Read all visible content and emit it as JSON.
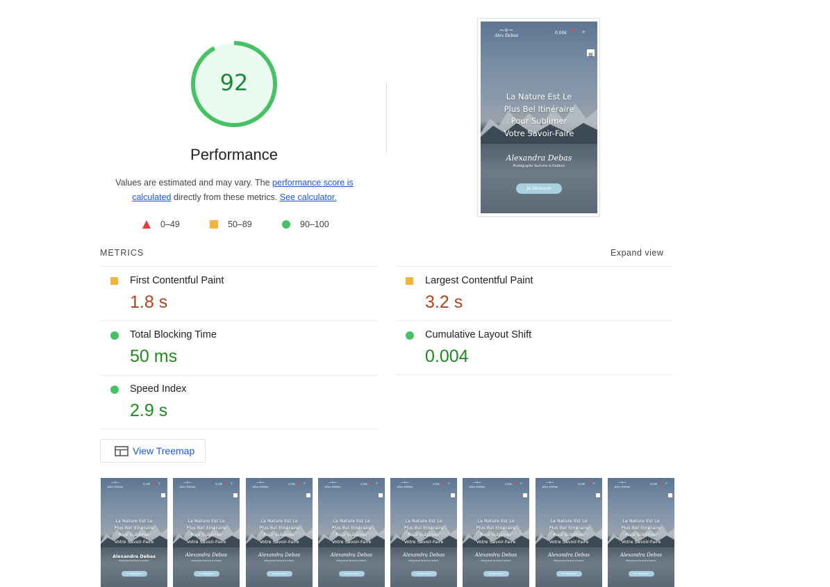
{
  "score": {
    "value": "92",
    "fraction": 0.92,
    "title": "Performance",
    "color": "#46c264"
  },
  "description": {
    "prefix": "Values are estimated and may vary. The ",
    "link1": "performance score is calculated",
    "middle": " directly from these metrics. ",
    "link2": "See calculator."
  },
  "legend": [
    {
      "shape": "triangle",
      "label": "0–49",
      "color": "#e53935"
    },
    {
      "shape": "square",
      "label": "50–89",
      "color": "#f4b33a"
    },
    {
      "shape": "circle",
      "label": "90–100",
      "color": "#46c264"
    }
  ],
  "metrics_header": "METRICS",
  "expand_label": "Expand view",
  "metrics": [
    {
      "name": "First Contentful Paint",
      "value": "1.8 s",
      "rating": "average"
    },
    {
      "name": "Largest Contentful Paint",
      "value": "3.2 s",
      "rating": "average"
    },
    {
      "name": "Total Blocking Time",
      "value": "50 ms",
      "rating": "pass"
    },
    {
      "name": "Cumulative Layout Shift",
      "value": "0.004",
      "rating": "pass"
    },
    {
      "name": "Speed Index",
      "value": "2.9 s",
      "rating": "pass"
    }
  ],
  "treemap_label": "View Treemap",
  "screenshot": {
    "logo_text": "Alex Debas",
    "cart_text": "0,00€",
    "headline_lines": [
      "La Nature Est Le",
      "Plus Bel Itinéraire",
      "Pour Sublimer",
      "Votre Savoir-Faire"
    ],
    "signature": "Alexandra Debas",
    "subtitle": "Photographe Tourisme & Outdoor",
    "button": "Je découvre"
  },
  "filmstrip": {
    "count": 8,
    "first_name_text": "Alexandra Debas"
  }
}
